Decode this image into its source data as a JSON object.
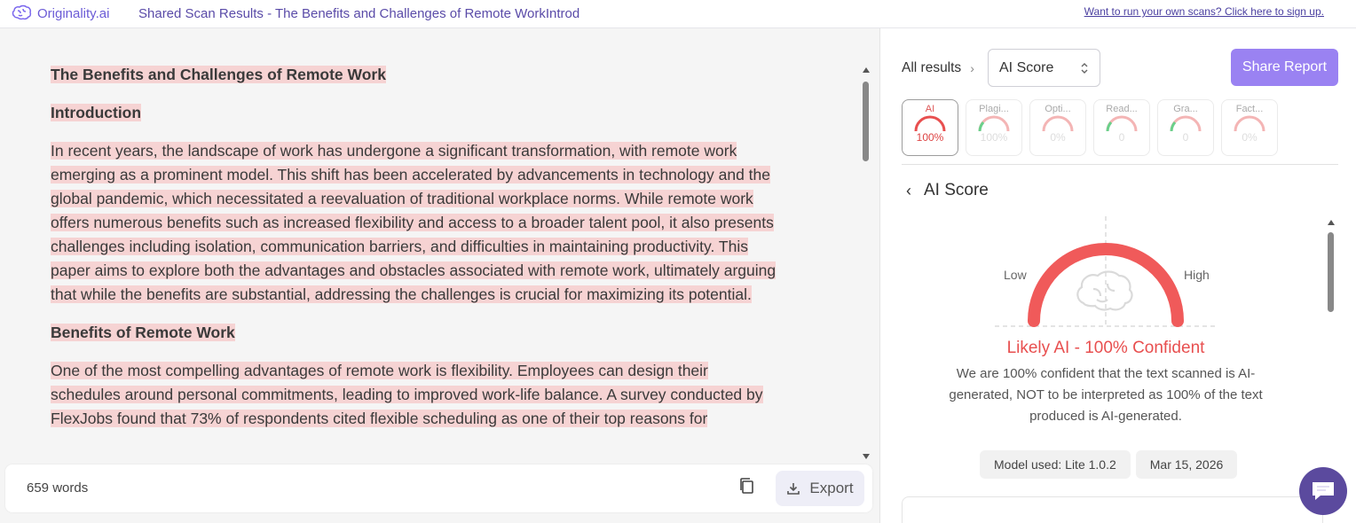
{
  "topbar": {
    "brand": "Originality.ai",
    "doc_title": "Shared Scan Results - The Benefits and Challenges of Remote WorkIntrod",
    "signup_link": "Want to run your own scans? Click here to sign up."
  },
  "document": {
    "title": "The Benefits and Challenges of Remote Work",
    "intro_heading": "Introduction",
    "intro_paragraph": "In recent years, the landscape of work has undergone a significant transformation, with remote work emerging as a prominent model. This shift has been accelerated by advancements in technology and the global pandemic, which necessitated a reevaluation of traditional workplace norms. While remote work offers numerous benefits such as increased flexibility and access to a broader talent pool, it also presents challenges including isolation, communication barriers, and difficulties in maintaining productivity. This paper aims to explore both the advantages and obstacles associated with remote work, ultimately arguing that while the benefits are substantial, addressing the challenges is crucial for maximizing its potential.",
    "benefits_heading": "Benefits of Remote Work",
    "benefits_paragraph": "One of the most compelling advantages of remote work is flexibility. Employees can design their schedules around personal commitments, leading to improved work-life balance. A survey conducted by FlexJobs found that 73% of respondents cited flexible scheduling as one of their top reasons for",
    "highlight_color": "#f6d3d3"
  },
  "footer": {
    "word_count": "659 words",
    "export_label": "Export"
  },
  "results": {
    "breadcrumb": "All results",
    "selected_view": "AI Score",
    "share_label": "Share Report",
    "tabs": [
      {
        "label": "AI",
        "value": "100%"
      },
      {
        "label": "Plagi...",
        "value": "100%"
      },
      {
        "label": "Opti...",
        "value": "0%"
      },
      {
        "label": "Read...",
        "value": "0"
      },
      {
        "label": "Gra...",
        "value": "0"
      },
      {
        "label": "Fact...",
        "value": "0%"
      }
    ],
    "section_title": "AI Score",
    "gauge": {
      "low_label": "Low",
      "high_label": "High",
      "score_fraction": 1.0,
      "color": "#f05a5a"
    },
    "verdict": "Likely AI - 100% Confident",
    "verdict_description": "We are 100% confident that the text scanned is AI-generated, NOT to be interpreted as 100% of the text produced is AI-generated.",
    "model_used": "Model used: Lite 1.0.2",
    "date": "Mar 15, 2026"
  },
  "colors": {
    "brand": "#6b5bd6",
    "share_button": "#9a82f2",
    "ai_red": "#e84f4f"
  }
}
